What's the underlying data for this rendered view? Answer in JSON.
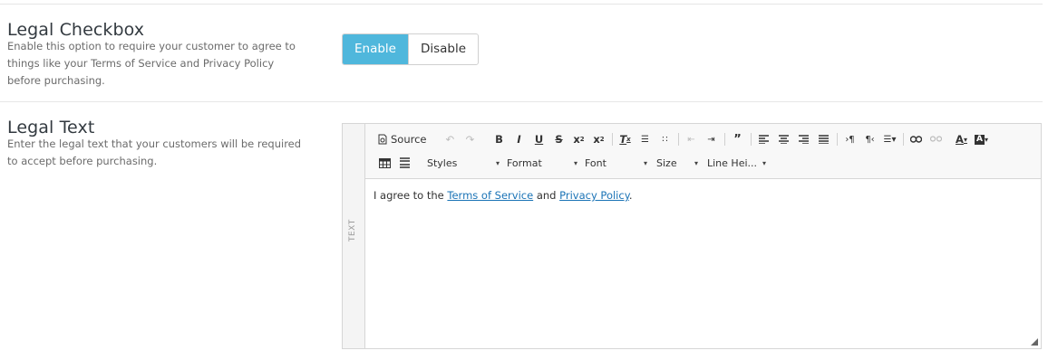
{
  "legal_checkbox": {
    "title": "Legal Checkbox",
    "description": "Enable this option to require your customer to agree to things like your Terms of Service and Privacy Policy before purchasing.",
    "enable_label": "Enable",
    "disable_label": "Disable",
    "selected": "Enable",
    "accent_color": "#4fb7dc"
  },
  "legal_text": {
    "title": "Legal Text",
    "description": "Enter the legal text that your customers will be required to accept before purchasing."
  },
  "editor": {
    "side_label": "TEXT",
    "toolbar": {
      "source_label": "Source",
      "styles_label": "Styles",
      "format_label": "Format",
      "font_label": "Font",
      "size_label": "Size",
      "line_height_label": "Line Hei..."
    },
    "content": {
      "prefix": "I agree to the ",
      "link1": "Terms of Service",
      "middle": " and ",
      "link2": "Privacy Policy",
      "suffix": "."
    }
  }
}
